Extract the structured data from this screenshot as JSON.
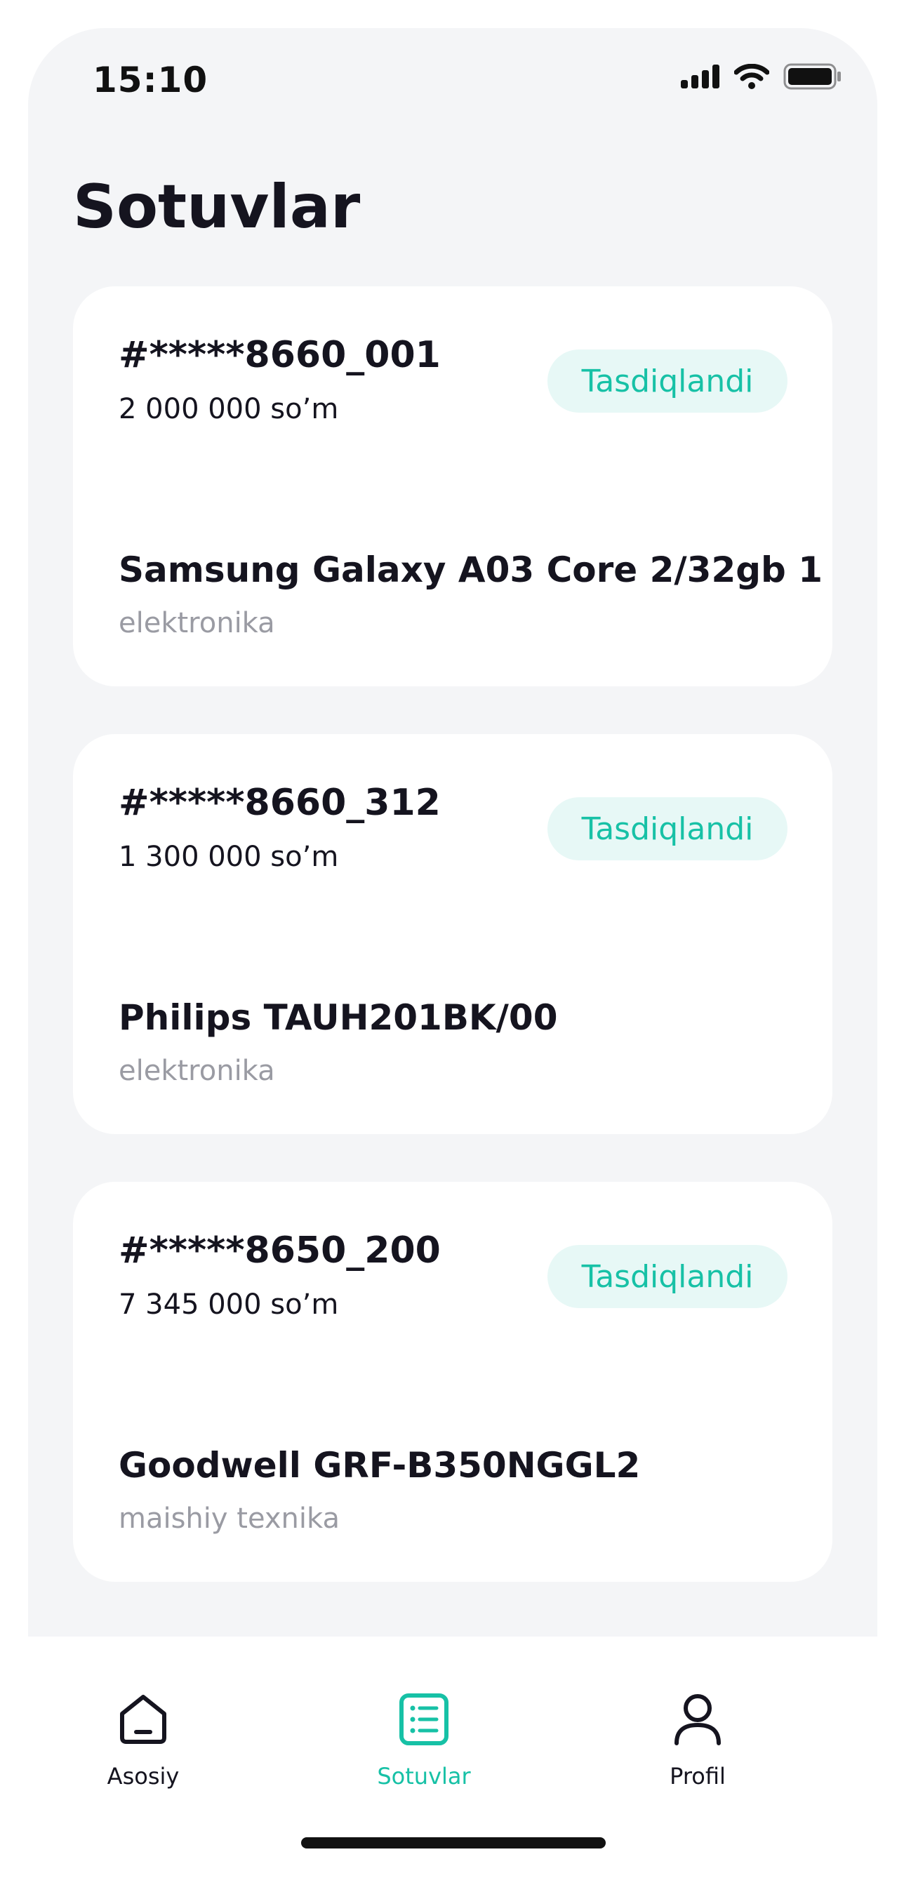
{
  "status_bar": {
    "time": "15:10"
  },
  "page": {
    "title": "Sotuvlar"
  },
  "sales": [
    {
      "id": "#*****8660_001",
      "price": "2 000 000 so’m",
      "status": "Tasdiqlandi",
      "product": "Samsung Galaxy A03 Core 2/32gb 1",
      "category": "elektronika"
    },
    {
      "id": "#*****8660_312",
      "price": "1 300 000 so’m",
      "status": "Tasdiqlandi",
      "product": "Philips TAUH201BK/00",
      "category": "elektronika"
    },
    {
      "id": "#*****8650_200",
      "price": "7 345 000 so’m",
      "status": "Tasdiqlandi",
      "product": "Goodwell GRF-B350NGGL2",
      "category": "maishiy texnika"
    }
  ],
  "tabbar": {
    "items": [
      {
        "label": "Asosiy",
        "icon": "home-icon",
        "active": false
      },
      {
        "label": "Sotuvlar",
        "icon": "list-icon",
        "active": true
      },
      {
        "label": "Profil",
        "icon": "user-icon",
        "active": false
      }
    ]
  },
  "colors": {
    "accent": "#17c1a6",
    "badge_bg": "#e7f8f6",
    "background": "#f4f5f7",
    "text": "#15141f",
    "muted": "#9a9ba3"
  }
}
